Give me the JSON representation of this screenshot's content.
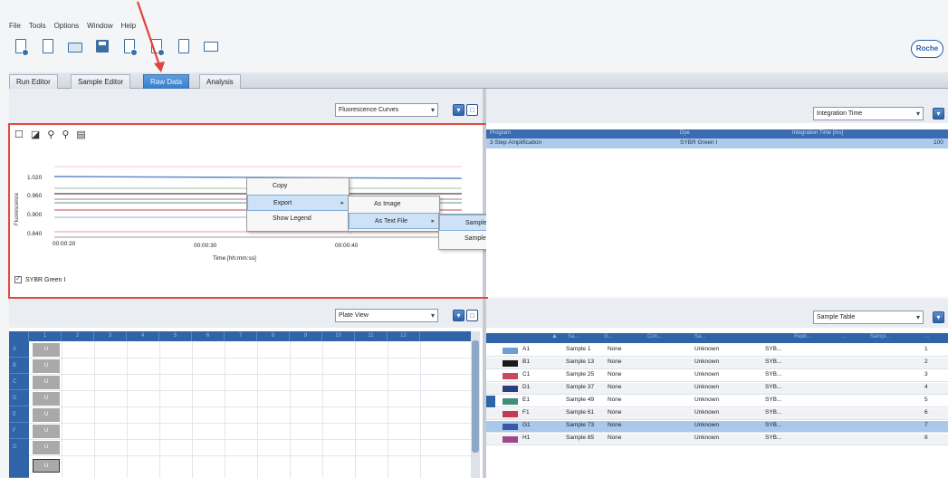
{
  "menu": [
    "File",
    "Tools",
    "Options",
    "Window",
    "Help"
  ],
  "brand": "Roche",
  "tabs": [
    {
      "label": "Run Editor",
      "active": false
    },
    {
      "label": "Sample Editor",
      "active": false
    },
    {
      "label": "Raw Data",
      "active": true
    },
    {
      "label": "Analysis",
      "active": false
    }
  ],
  "chart_panel": {
    "view_select": "Fluorescence Curves",
    "ylabel": "Fluorescence",
    "yticks": [
      "1.020",
      "0.960",
      "0.900",
      "0.840"
    ],
    "xticks": [
      "00:00:20",
      "00:00:30",
      "00:00:40"
    ],
    "xlabel": "Time [hh:mm:ss]",
    "legend_item": "SYBR Green I"
  },
  "context_menu": {
    "main": [
      "Copy",
      "Export",
      "Show Legend"
    ],
    "export_sub": [
      "As Image",
      "As Text File"
    ],
    "text_sub": [
      "Samples as Rows",
      "Samples as Columns"
    ]
  },
  "program_panel": {
    "select": "Integration Time",
    "headers": [
      "Program",
      "Dye",
      "Integration Time [ms]"
    ],
    "row": [
      "3 Step Amplification",
      "SYBR Green I",
      "100"
    ]
  },
  "plate_panel": {
    "select": "Plate View",
    "columns": [
      "1",
      "2",
      "3",
      "4",
      "5",
      "6",
      "7",
      "8",
      "9",
      "10",
      "11",
      "12"
    ],
    "rows": [
      "A",
      "B",
      "C",
      "D",
      "E",
      "F",
      "G"
    ],
    "well_label": "U"
  },
  "sample_panel": {
    "select": "Sample Table",
    "headers": [
      "Sa...",
      "G...",
      "Con...",
      "Sa...",
      "Repli...",
      "...",
      "Sampl...",
      "..."
    ],
    "rows": [
      {
        "pos": "A1",
        "name": "Sample 1",
        "group": "None",
        "type": "Unknown",
        "dye": "SYB...",
        "num": "1",
        "color": "#6f9ed6"
      },
      {
        "pos": "B1",
        "name": "Sample 13",
        "group": "None",
        "type": "Unknown",
        "dye": "SYB...",
        "num": "2",
        "color": "#1a1a1a"
      },
      {
        "pos": "C1",
        "name": "Sample 25",
        "group": "None",
        "type": "Unknown",
        "dye": "SYB...",
        "num": "3",
        "color": "#c94a5a"
      },
      {
        "pos": "D1",
        "name": "Sample 37",
        "group": "None",
        "type": "Unknown",
        "dye": "SYB...",
        "num": "4",
        "color": "#2d3f78"
      },
      {
        "pos": "E1",
        "name": "Sample 49",
        "group": "None",
        "type": "Unknown",
        "dye": "SYB...",
        "num": "5",
        "color": "#3f8f7a"
      },
      {
        "pos": "F1",
        "name": "Sample 61",
        "group": "None",
        "type": "Unknown",
        "dye": "SYB...",
        "num": "6",
        "color": "#c43a52"
      },
      {
        "pos": "G1",
        "name": "Sample 73",
        "group": "None",
        "type": "Unknown",
        "dye": "SYB...",
        "num": "7",
        "color": "#3a58a8"
      },
      {
        "pos": "H1",
        "name": "Sample 85",
        "group": "None",
        "type": "Unknown",
        "dye": "SYB...",
        "num": "8",
        "color": "#9a4a86"
      }
    ]
  },
  "colors": {
    "accent": "#3a7cc8",
    "highlight": "#e04a44",
    "header": "#2f64a8"
  },
  "icons": [
    "new-run-icon",
    "new-document-icon",
    "open-folder-icon",
    "save-icon",
    "export-icon",
    "import-icon",
    "blank-document-icon",
    "screen-icon"
  ]
}
